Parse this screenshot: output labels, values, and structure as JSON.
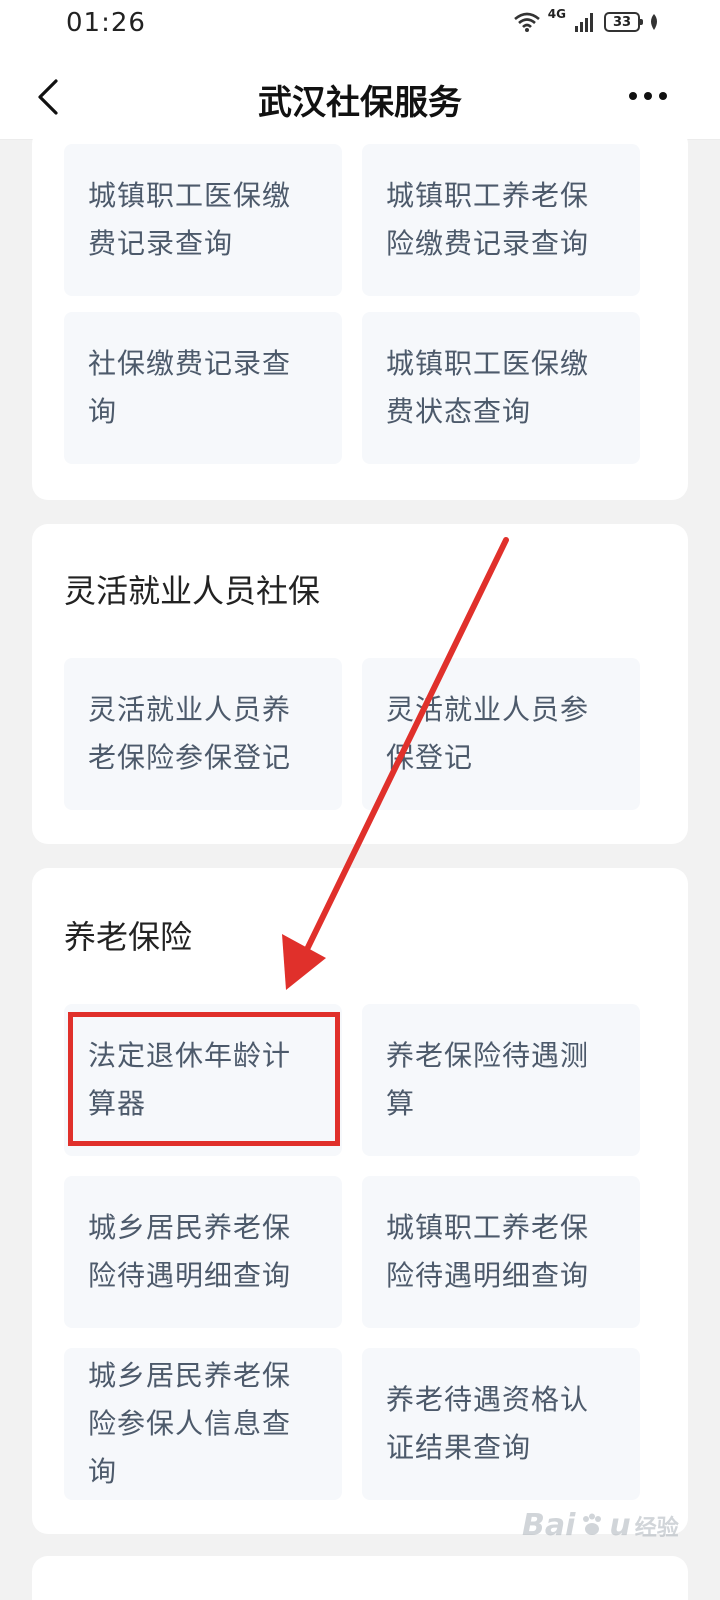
{
  "status_bar": {
    "time": "01:26",
    "network": "4G",
    "battery": "33"
  },
  "header": {
    "title": "武汉社保服务",
    "back_icon": "chevron-left-icon",
    "more_icon": "more-horizontal-icon"
  },
  "sections": [
    {
      "title": "",
      "items": [
        {
          "label": "城镇职工医保缴费记录查询"
        },
        {
          "label": "城镇职工养老保险缴费记录查询"
        },
        {
          "label": "社保缴费记录查询"
        },
        {
          "label": "城镇职工医保缴费状态查询"
        }
      ]
    },
    {
      "title": "灵活就业人员社保",
      "items": [
        {
          "label": "灵活就业人员养老保险参保登记"
        },
        {
          "label": "灵活就业人员参保登记"
        }
      ]
    },
    {
      "title": "养老保险",
      "items": [
        {
          "label": "法定退休年龄计算器"
        },
        {
          "label": "养老保险待遇测算"
        },
        {
          "label": "城乡居民养老保险待遇明细查询"
        },
        {
          "label": "城镇职工养老保险待遇明细查询"
        },
        {
          "label": "城乡居民养老保险参保人信息查询"
        },
        {
          "label": "养老待遇资格认证结果查询"
        }
      ]
    }
  ],
  "annotation": {
    "color": "#e0302b"
  },
  "watermark": {
    "brand": "Bai",
    "brand_end": "u",
    "sub": "经验"
  }
}
